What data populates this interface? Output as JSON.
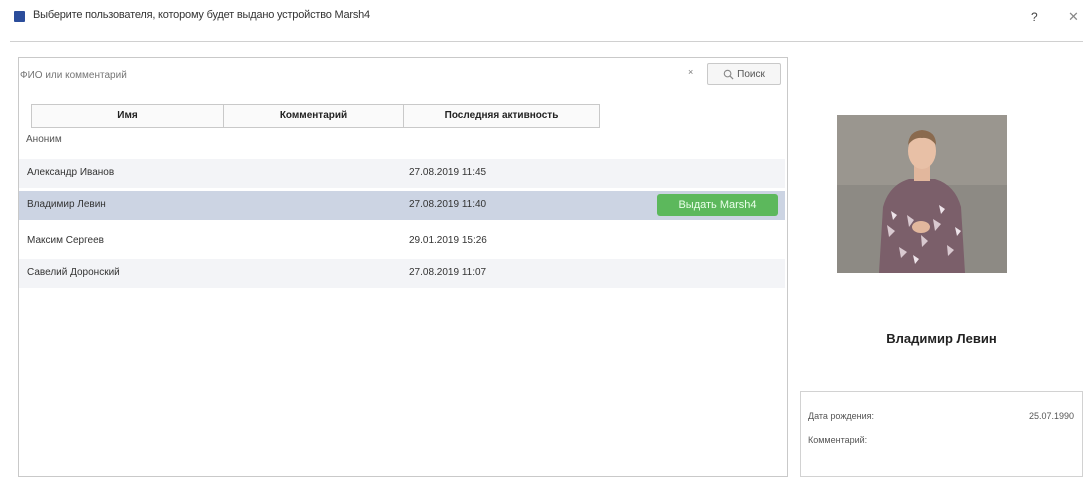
{
  "window": {
    "title": "Выберите пользователя, которому будет выдано устройство Marsh4",
    "help_label": "?",
    "close_label": "✕"
  },
  "search": {
    "value": "",
    "placeholder": "ФИО или комментарий",
    "clear_label": "×",
    "button_label": "Поиск"
  },
  "table": {
    "columns": [
      "Имя",
      "Комментарий",
      "Последняя активность"
    ],
    "group_label": "Аноним",
    "rows": [
      {
        "name": "Александр Иванов",
        "comment": "",
        "activity": "27.08.2019 11:45",
        "selected": false
      },
      {
        "name": "Владимир Левин",
        "comment": "",
        "activity": "27.08.2019 11:40",
        "selected": true
      },
      {
        "name": "Максим Сергеев",
        "comment": "",
        "activity": "29.01.2019 15:26",
        "selected": false
      },
      {
        "name": "Савелий Доронский",
        "comment": "",
        "activity": "27.08.2019 11:07",
        "selected": false
      }
    ],
    "issue_button_label": "Выдать Marsh4"
  },
  "profile": {
    "name": "Владимир Левин",
    "birth_label": "Дата рождения:",
    "birth_value": "25.07.1990",
    "comment_label": "Комментарий:"
  },
  "colors": {
    "accent_green": "#5cb85c",
    "selected_row": "#ccd4e3",
    "app_icon": "#2b4d9b"
  }
}
